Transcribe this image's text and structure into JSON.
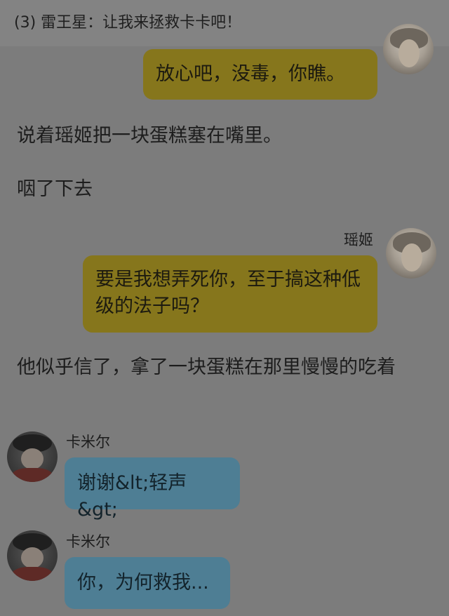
{
  "header": {
    "title": "(3) 雷王星：让我来拯救卡卡吧！"
  },
  "messages": [
    {
      "sender": "",
      "text": "放心吧，没毒，你瞧。"
    },
    {
      "sender": "瑶姬",
      "text": "要是我想弄死你，至于搞这种低级的法子吗？"
    },
    {
      "sender": "卡米尔",
      "text": "谢谢&lt;轻声&gt;"
    },
    {
      "sender": "卡米尔",
      "text": "你，为何救我..."
    }
  ],
  "narration": [
    "说着瑶姬把一块蛋糕塞在嘴里。",
    "咽了下去",
    "他似乎信了，拿了一块蛋糕在那里慢慢的吃着"
  ],
  "colors": {
    "background": "#7c7c7c",
    "bubble_self": "#86761c",
    "bubble_other": "#4e7e94"
  }
}
